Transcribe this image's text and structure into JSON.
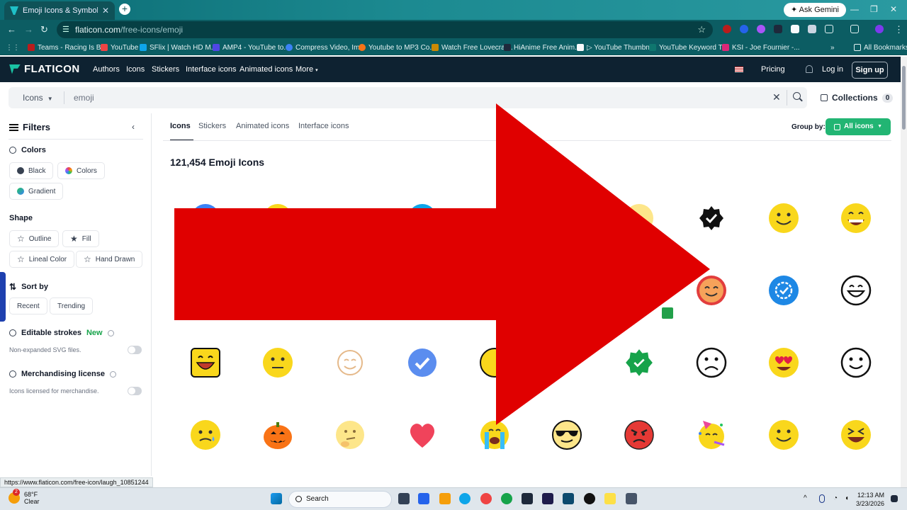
{
  "browser": {
    "tab_title": "Emoji Icons & Symbols",
    "ask_gemini": "Ask Gemini",
    "url_host": "flaticon.com",
    "url_path": "/free-icons/emoji",
    "bookmarks": [
      {
        "label": "Teams - Racing Is B...",
        "color": "#b91c1c"
      },
      {
        "label": "YouTube",
        "color": "#ef4444"
      },
      {
        "label": "SFlix | Watch HD M...",
        "color": "#0ea5e9"
      },
      {
        "label": "AMP4 - YouTube to...",
        "color": "#4f46e5"
      },
      {
        "label": "Compress Video, Im...",
        "color": "#3b82f6"
      },
      {
        "label": "Youtube to MP3 Co...",
        "color": "#f97316"
      },
      {
        "label": "Watch Free Lovecraf...",
        "color": "#ca8a04"
      },
      {
        "label": "HiAnime Free Anim...",
        "color": "#1e293b"
      },
      {
        "label": "▷ YouTube Thumbn...",
        "color": "#f8fafc"
      },
      {
        "label": "YouTube Keyword T...",
        "color": "#0f766e"
      },
      {
        "label": "KSI - Joe Fournier -...",
        "color": "#db2777"
      }
    ],
    "all_bookmarks": "All Bookmarks",
    "status_url": "https://www.flaticon.com/free-icon/laugh_10851244"
  },
  "header": {
    "logo": "FLATICON",
    "nav": [
      "Authors",
      "Icons",
      "Stickers",
      "Interface icons",
      "Animated icons",
      "More"
    ],
    "pricing": "Pricing",
    "login": "Log in",
    "signup": "Sign up"
  },
  "search": {
    "type": "Icons",
    "query": "emoji",
    "collections": "Collections",
    "collections_count": "0"
  },
  "sidebar": {
    "title": "Filters",
    "colors_label": "Colors",
    "color_chips": [
      "Black",
      "Colors",
      "Gradient"
    ],
    "shape_label": "Shape",
    "shape_chips": [
      "Outline",
      "Fill",
      "Lineal Color",
      "Hand Drawn"
    ],
    "sort_label": "Sort by",
    "sort_chips": [
      "Recent",
      "Trending"
    ],
    "editable_label": "Editable strokes",
    "editable_new": "New",
    "editable_note": "Non-expanded SVG files.",
    "merch_label": "Merchandising license",
    "merch_note": "Icons licensed for merchandise."
  },
  "main": {
    "tabs": [
      "Icons",
      "Stickers",
      "Animated icons",
      "Interface icons"
    ],
    "group_by": "Group by:",
    "all_icons": "All icons",
    "result_count": "121,454 Emoji Icons"
  },
  "colors": {
    "arrow": "#e00000",
    "accent_green": "#22b573",
    "header_bg": "#0e2231",
    "emoji_yellow": "#f9d71c"
  },
  "taskbar": {
    "temp": "68°F",
    "condition": "Clear",
    "weather_badge": "2",
    "search": "Search",
    "time": "12:13 AM",
    "date": "3/23/2026"
  }
}
